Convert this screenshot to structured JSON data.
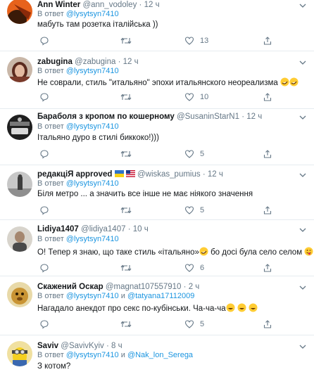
{
  "reply_prefix": "В ответ",
  "conj_and": "и",
  "tweets": [
    {
      "name": "Ann Winter",
      "handle": "@ann_vodoley",
      "time": "12 ч",
      "mentions": [
        "@lysytsyn7410"
      ],
      "text": "мабуть там розетка італійська ))",
      "likes": "13",
      "replies": ""
    },
    {
      "name": "zabugina",
      "handle": "@zabugina",
      "time": "12 ч",
      "mentions": [
        "@lysytsyn7410"
      ],
      "text": "Не соврали, стиль \"итальяно\" эпохи итальянского неореализма",
      "likes": "10",
      "replies": ""
    },
    {
      "name": "Бараболя з кропом по кошерному",
      "handle": "@SusaninStarN1",
      "time": "12 ч",
      "mentions": [
        "@lysytsyn7410"
      ],
      "text": "Італьяно дуро в стилі биккоко!)))",
      "likes": "5",
      "replies": ""
    },
    {
      "name": "редакціЯ approved",
      "handle": "@wiskas_pumius",
      "time": "12 ч",
      "mentions": [
        "@lysytsyn7410"
      ],
      "text": "Біля метро ... а значить все інше не має ніякого значення",
      "likes": "5",
      "replies": ""
    },
    {
      "name": "Lidiya1407",
      "handle": "@lidiya1407",
      "time": "10 ч",
      "mentions": [
        "@lysytsyn7410"
      ],
      "text_a": "О! Тепер я знаю, що таке стиль «італьяно»",
      "text_b": " бо досі була село селом",
      "likes": "6",
      "replies": ""
    },
    {
      "name": "Скажений Оскар",
      "handle": "@magnat107557910",
      "time": "2 ч",
      "mentions": [
        "@lysytsyn7410",
        "@tatyana17112009"
      ],
      "text": "Нагадало анекдот про секс по-кубінськи. Ча-ча-ча",
      "likes": "5",
      "replies": ""
    },
    {
      "name": "Saviv",
      "handle": "@SavivKyiv",
      "time": "8 ч",
      "mentions": [
        "@lysytsyn7410",
        "@Nak_lon_Serega"
      ],
      "text": "З котом?",
      "likes": "",
      "replies": ""
    }
  ],
  "colors": {
    "link": "#1b95e0",
    "muted": "#657786",
    "text": "#14171a",
    "border": "#e6ecf0"
  }
}
